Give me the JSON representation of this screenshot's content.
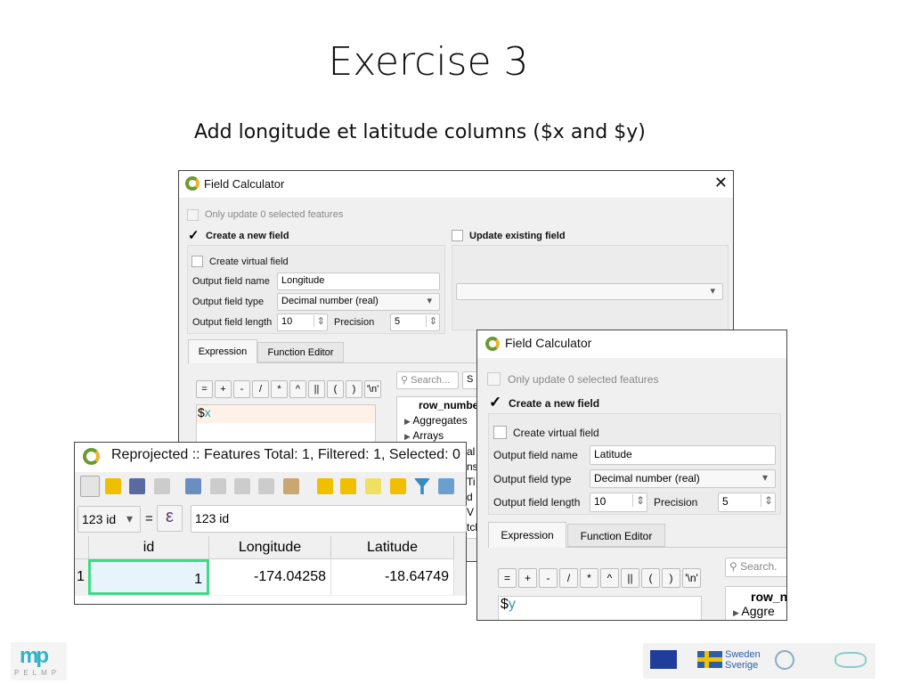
{
  "slide": {
    "title": "Exercise 3",
    "subtitle": "Add longitude et latitude columns ($x and $y)"
  },
  "dialog_longitude": {
    "title": "Field Calculator",
    "only_update": "Only update 0 selected features",
    "create_new": "Create a new field",
    "update_existing": "Update existing field",
    "virtual": "Create virtual field",
    "name_label": "Output field name",
    "name_value": "Longitude",
    "type_label": "Output field type",
    "type_value": "Decimal number (real)",
    "length_label": "Output field length",
    "length_value": "10",
    "precision_label": "Precision",
    "precision_value": "5",
    "tab_expression": "Expression",
    "tab_function_editor": "Function Editor",
    "operators": [
      "=",
      "+",
      "-",
      "/",
      "*",
      "^",
      "||",
      "(",
      ")",
      "'\\n'"
    ],
    "expression_prefix": "$",
    "expression_var": "x",
    "search_placeholder": "Search...",
    "show_help": "S",
    "functions": [
      "row_numbe",
      "Aggregates",
      "Arrays"
    ],
    "partial_items": [
      "al",
      "ns",
      "Ti",
      "d V",
      "tch"
    ]
  },
  "dialog_latitude": {
    "title": "Field Calculator",
    "only_update": "Only update 0 selected features",
    "create_new": "Create a new field",
    "virtual": "Create virtual field",
    "name_label": "Output field name",
    "name_value": "Latitude",
    "type_label": "Output field type",
    "type_value": "Decimal number (real)",
    "length_label": "Output field length",
    "length_value": "10",
    "precision_label": "Precision",
    "precision_value": "5",
    "tab_expression": "Expression",
    "tab_function_editor": "Function Editor",
    "operators": [
      "=",
      "+",
      "-",
      "/",
      "*",
      "^",
      "||",
      "(",
      ")",
      "'\\n'"
    ],
    "expression_prefix": "$",
    "expression_var": "y",
    "search_placeholder": "Search.",
    "functions": [
      "row_n",
      "Aggre"
    ]
  },
  "attribute_table": {
    "title": "Reprojected :: Features Total: 1, Filtered: 1, Selected: 0",
    "field_combo": "123 id",
    "equals": "=",
    "epsilon": "ε",
    "filter_value": "123 id",
    "columns": [
      "id",
      "Longitude",
      "Latitude"
    ],
    "rows": [
      {
        "num": "1",
        "cells": [
          "1",
          "-174.04258",
          "-18.64749"
        ]
      }
    ],
    "toolbar_icons": [
      "edit-pencil-icon",
      "multi-edit-icon",
      "save-edits-icon",
      "reload-icon",
      "add-feature-icon",
      "delete-icon",
      "cut-icon",
      "copy-icon",
      "paste-icon",
      "expression-select-icon",
      "select-all-icon",
      "invert-selection-icon",
      "deselect-icon",
      "filter-icon",
      "move-selection-top-icon"
    ]
  },
  "footer": {
    "left_logo": "PELMP",
    "right_logos": [
      "EU",
      "Sweden Sverige",
      "partner-logo",
      "partner-logo-2"
    ]
  },
  "colors": {
    "check_green": "#3ddc84",
    "qgis_green": "#6a9b2f",
    "selection": "#e8f4fc"
  }
}
